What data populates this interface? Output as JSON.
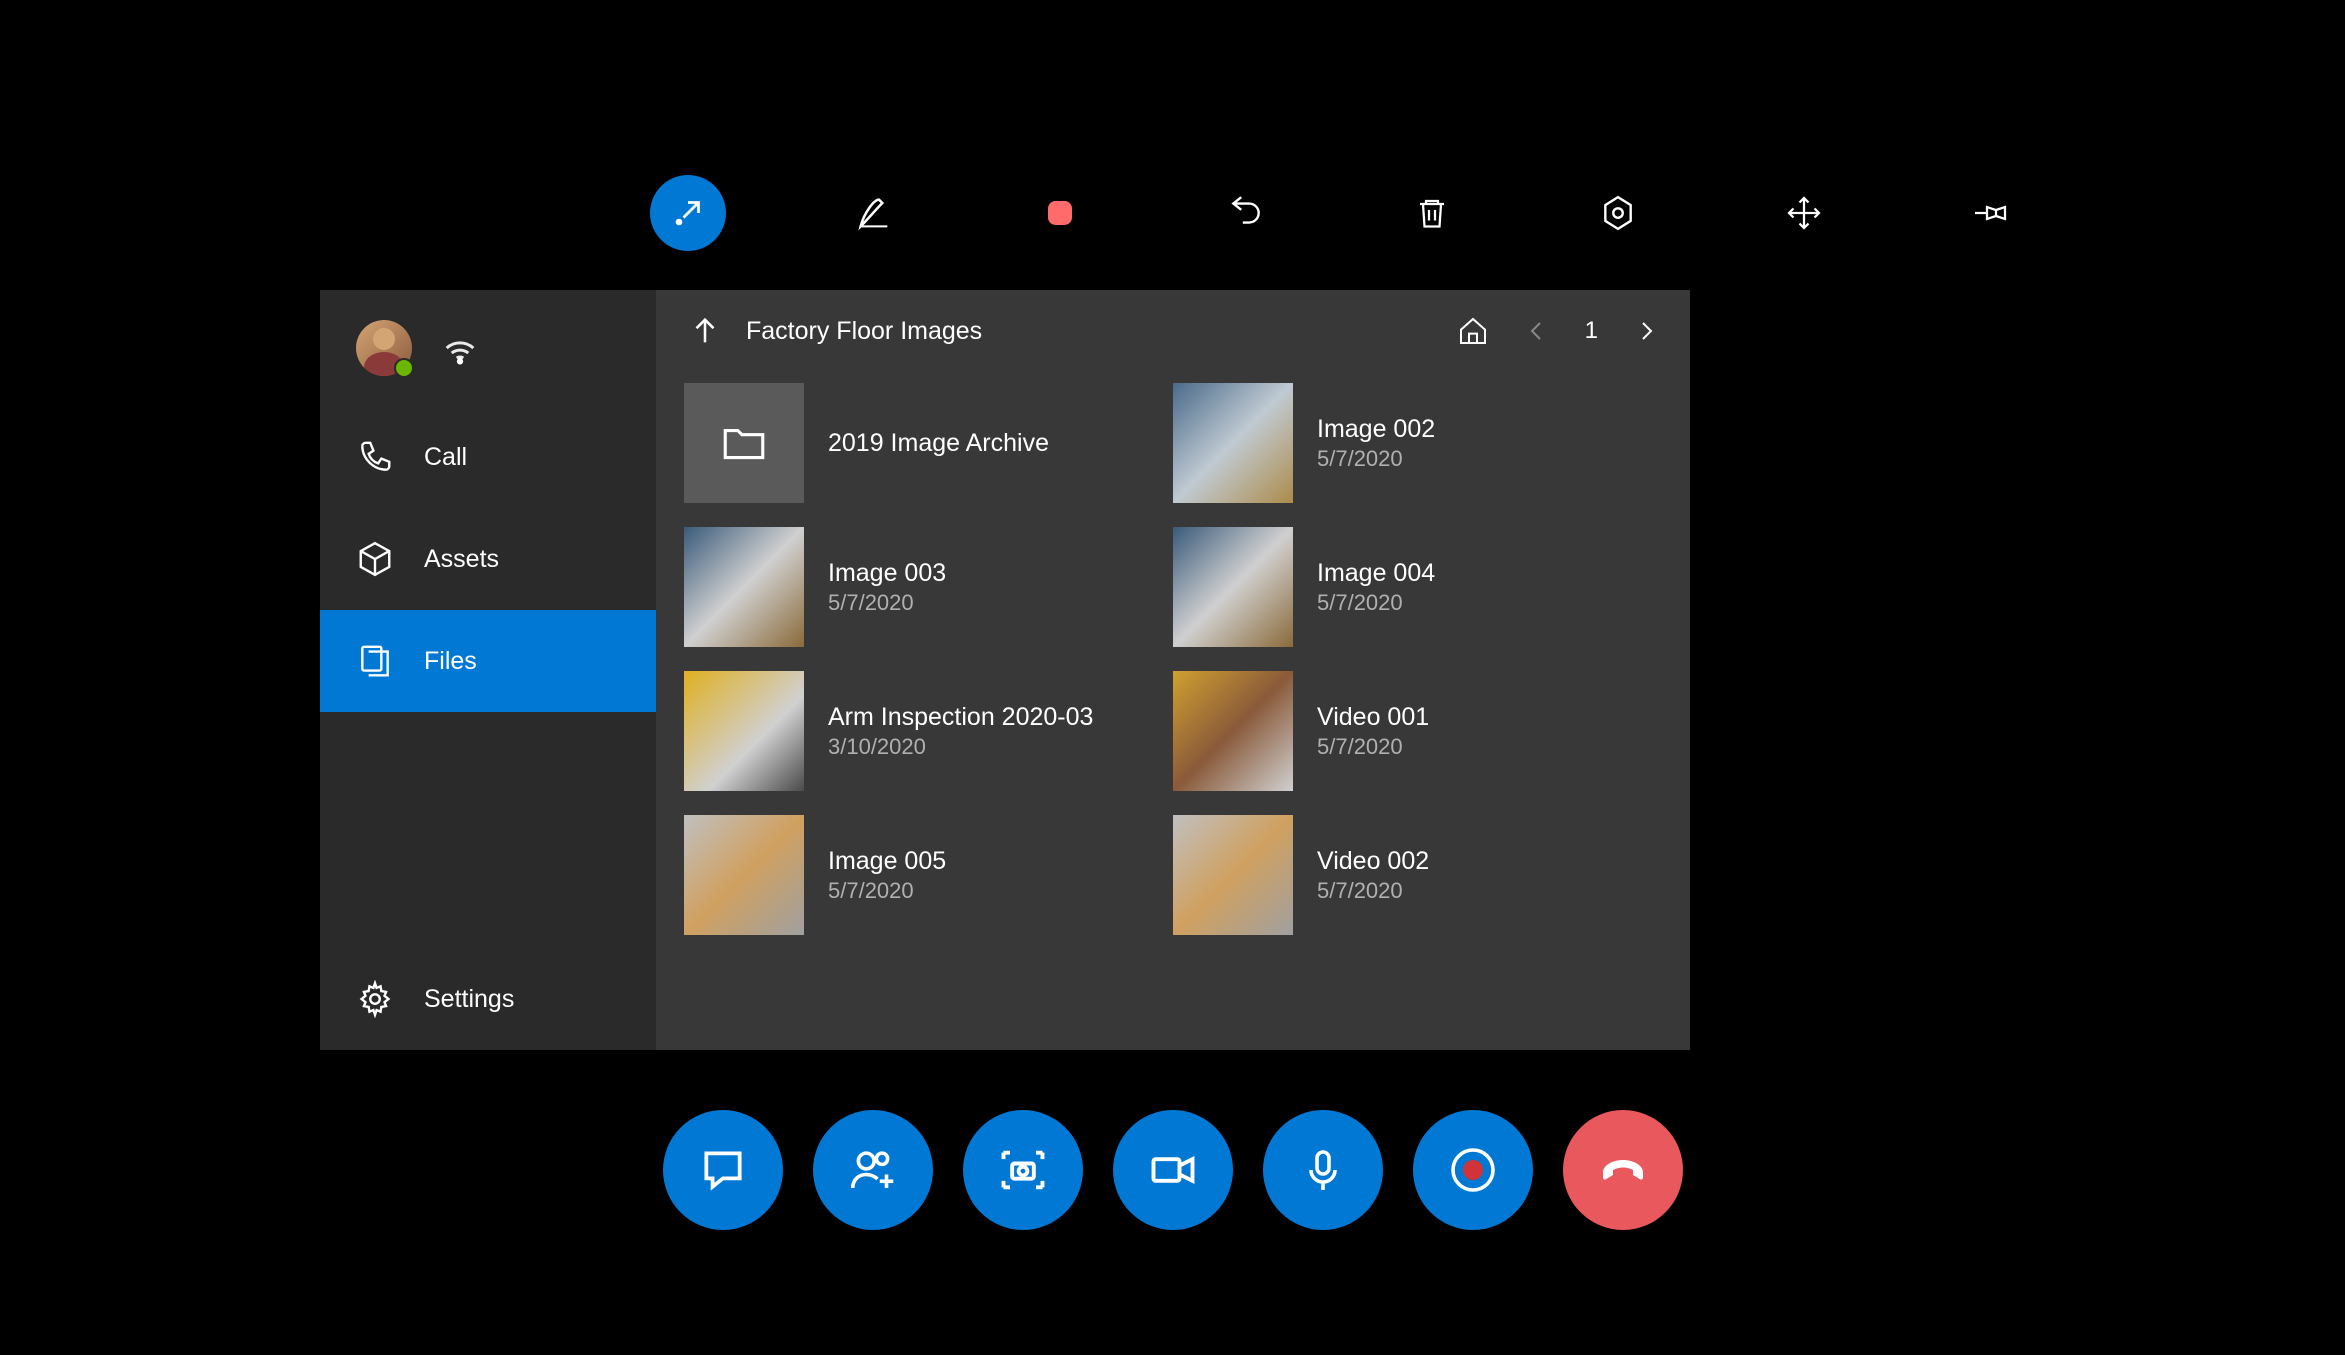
{
  "sidebar": {
    "call": "Call",
    "assets": "Assets",
    "files": "Files",
    "settings": "Settings"
  },
  "content": {
    "breadcrumb": "Factory Floor Images",
    "page": "1"
  },
  "files": [
    {
      "name": "2019 Image Archive",
      "date": "",
      "type": "folder"
    },
    {
      "name": "Image 002",
      "date": "5/7/2020",
      "type": "image"
    },
    {
      "name": "Image 003",
      "date": "5/7/2020",
      "type": "image"
    },
    {
      "name": "Image 004",
      "date": "5/7/2020",
      "type": "image"
    },
    {
      "name": "Arm Inspection 2020-03",
      "date": "3/10/2020",
      "type": "image"
    },
    {
      "name": "Video 001",
      "date": "5/7/2020",
      "type": "video"
    },
    {
      "name": "Image 005",
      "date": "5/7/2020",
      "type": "image"
    },
    {
      "name": "Video 002",
      "date": "5/7/2020",
      "type": "video"
    }
  ]
}
